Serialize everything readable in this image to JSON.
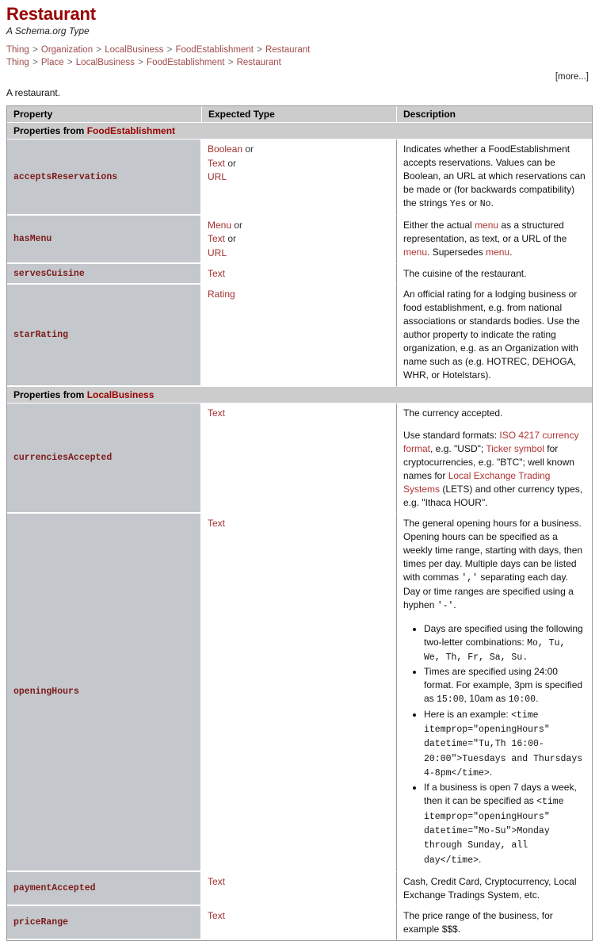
{
  "page": {
    "title": "Restaurant",
    "subtitle": "A Schema.org Type",
    "description": "A restaurant.",
    "more_label": "[more...]"
  },
  "breadcrumbs": [
    [
      "Thing",
      "Organization",
      "LocalBusiness",
      "FoodEstablishment",
      "Restaurant"
    ],
    [
      "Thing",
      "Place",
      "LocalBusiness",
      "FoodEstablishment",
      "Restaurant"
    ]
  ],
  "breadcrumb_separator": ">",
  "table": {
    "headers": [
      "Property",
      "Expected Type",
      "Description"
    ],
    "sections": [
      {
        "label_prefix": "Properties from ",
        "label_type": "FoodEstablishment",
        "rows": [
          {
            "property": "acceptsReservations",
            "types": [
              "Boolean",
              "Text",
              "URL"
            ],
            "description": "Indicates whether a FoodEstablishment accepts reservations. Values can be Boolean, an URL at which reservations can be made or (for backwards compatibility) the strings Yes or No."
          },
          {
            "property": "hasMenu",
            "types": [
              "Menu",
              "Text",
              "URL"
            ],
            "description": "Either the actual menu as a structured representation, as text, or a URL of the menu. Supersedes menu."
          },
          {
            "property": "servesCuisine",
            "types": [
              "Text"
            ],
            "description": "The cuisine of the restaurant."
          },
          {
            "property": "starRating",
            "types": [
              "Rating"
            ],
            "description": "An official rating for a lodging business or food establishment, e.g. from national associations or standards bodies. Use the author property to indicate the rating organization, e.g. as an Organization with name such as (e.g. HOTREC, DEHOGA, WHR, or Hotelstars)."
          }
        ]
      },
      {
        "label_prefix": "Properties from ",
        "label_type": "LocalBusiness",
        "rows": [
          {
            "property": "currenciesAccepted",
            "types": [
              "Text"
            ],
            "description": "The currency accepted.",
            "description2_parts": [
              {
                "t": "Use standard formats: ",
                "k": "plain"
              },
              {
                "t": "ISO 4217 currency format",
                "k": "link"
              },
              {
                "t": ", e.g. \"USD\"; ",
                "k": "plain"
              },
              {
                "t": "Ticker symbol",
                "k": "link"
              },
              {
                "t": " for cryptocurrencies, e.g. \"BTC\"; well known names for ",
                "k": "plain"
              },
              {
                "t": "Local Exchange Trading Systems",
                "k": "link"
              },
              {
                "t": " (LETS) and other currency types, e.g. \"Ithaca HOUR\".",
                "k": "plain"
              }
            ]
          },
          {
            "property": "openingHours",
            "types": [
              "Text"
            ],
            "description": "The general opening hours for a business. Opening hours can be specified as a weekly time range, starting with days, then times per day. Multiple days can be listed with commas ',' separating each day. Day or time ranges are specified using a hyphen '-'.",
            "bullets": [
              {
                "parts": [
                  {
                    "t": "Days are specified using the following two-letter combinations: ",
                    "k": "plain"
                  },
                  {
                    "t": "Mo, Tu, We, Th, Fr, Sa, Su.",
                    "k": "code"
                  }
                ]
              },
              {
                "parts": [
                  {
                    "t": "Times are specified using 24:00 format. For example, 3pm is specified as ",
                    "k": "plain"
                  },
                  {
                    "t": "15:00",
                    "k": "code"
                  },
                  {
                    "t": ", 10am as ",
                    "k": "plain"
                  },
                  {
                    "t": "10:00",
                    "k": "code"
                  },
                  {
                    "t": ".",
                    "k": "plain"
                  }
                ]
              },
              {
                "parts": [
                  {
                    "t": "Here is an example: ",
                    "k": "plain"
                  },
                  {
                    "t": "<time itemprop=\"openingHours\" datetime=\"Tu,Th 16:00-20:00\">Tuesdays and Thursdays 4-8pm</time>",
                    "k": "code"
                  },
                  {
                    "t": ".",
                    "k": "plain"
                  }
                ]
              },
              {
                "parts": [
                  {
                    "t": "If a business is open 7 days a week, then it can be specified as ",
                    "k": "plain"
                  },
                  {
                    "t": "<time itemprop=\"openingHours\" datetime=\"Mo-Su\">Monday through Sunday, all day</time>",
                    "k": "code"
                  },
                  {
                    "t": ".",
                    "k": "plain"
                  }
                ]
              }
            ]
          },
          {
            "property": "paymentAccepted",
            "types": [
              "Text"
            ],
            "description": "Cash, Credit Card, Cryptocurrency, Local Exchange Tradings System, etc."
          },
          {
            "property": "priceRange",
            "types": [
              "Text"
            ],
            "description": "The price range of the business, for example $$$."
          }
        ]
      }
    ],
    "or_word": "or"
  },
  "colors": {
    "title": "#990000",
    "link": "#a04a4a",
    "property_name": "#7d1a1a",
    "header_bg": "#cccccc",
    "property_cell_bg": "#c4c8cc"
  }
}
